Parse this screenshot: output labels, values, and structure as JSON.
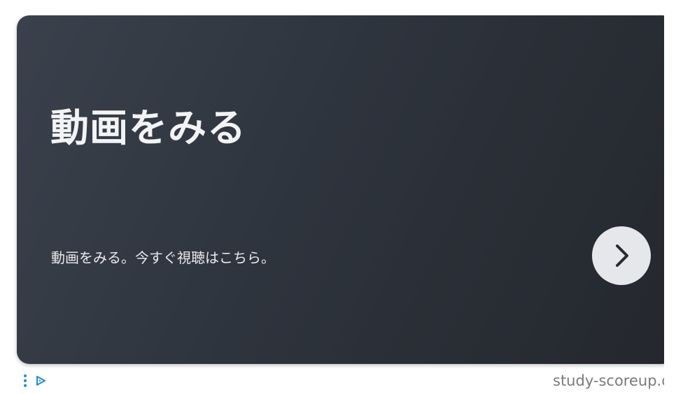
{
  "ad": {
    "headline": "動画をみる",
    "subtitle": "動画をみる。今すぐ視聴はこちら。",
    "cta_icon": "chevron-right-icon",
    "domain": "study-scoreup.c"
  },
  "footer": {
    "options_icon": "vertical-dots-icon",
    "adchoices_icon": "adchoices-icon"
  },
  "colors": {
    "card_start": "#3a414c",
    "card_end": "#24272d",
    "button_bg": "#e6e7ea",
    "accent": "#1a8ccf",
    "domain_text": "#7a7a7a"
  }
}
